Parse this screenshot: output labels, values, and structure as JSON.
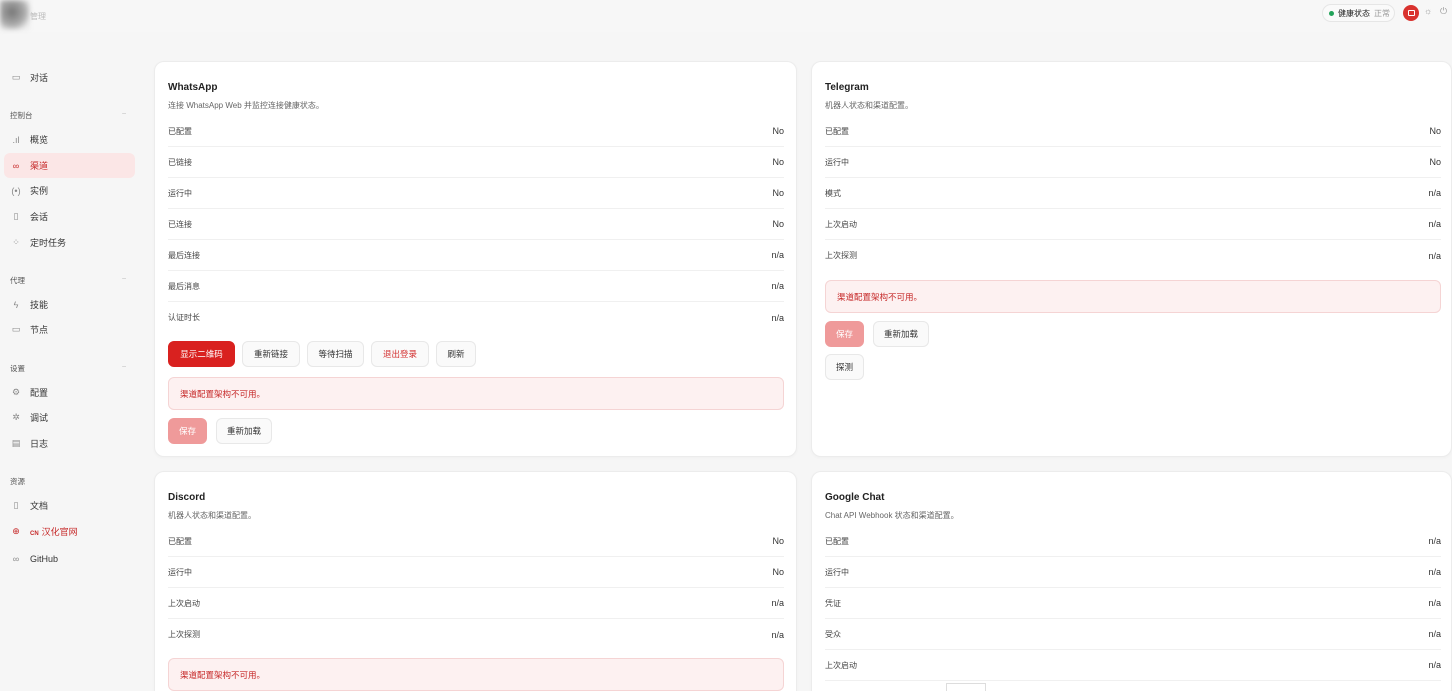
{
  "topbar": {
    "logo_text": "管理",
    "health_label": "健康状态",
    "health_status": "正常",
    "health_color": "#22a35a",
    "accent": "#d9322e",
    "icons": [
      "chat-icon",
      "sun-icon",
      "power-icon"
    ]
  },
  "sidebar": {
    "chat": "对话",
    "groups": {
      "control": "控制台",
      "agent": "代理",
      "settings": "设置",
      "resources": "资源"
    },
    "items": {
      "overview": "概览",
      "channels": "渠道",
      "instances": "实例",
      "sessions": "会话",
      "cron": "定时任务",
      "skills": "技能",
      "nodes": "节点",
      "config": "配置",
      "debug": "调试",
      "logs": "日志",
      "docs": "文档",
      "cn_badge": "CN",
      "cn_site": "汉化官网",
      "github": "GitHub"
    }
  },
  "whatsapp": {
    "title": "WhatsApp",
    "subtitle": "连接 WhatsApp Web 并监控连接健康状态。",
    "rows": [
      {
        "label": "已配置",
        "value": "No"
      },
      {
        "label": "已链接",
        "value": "No"
      },
      {
        "label": "运行中",
        "value": "No"
      },
      {
        "label": "已连接",
        "value": "No"
      },
      {
        "label": "最后连接",
        "value": "n/a"
      },
      {
        "label": "最后消息",
        "value": "n/a"
      },
      {
        "label": "认证时长",
        "value": "n/a"
      }
    ],
    "buttons": {
      "show_qr": "显示二维码",
      "relink": "重新链接",
      "wait_scan": "等待扫描",
      "logout": "退出登录",
      "refresh": "刷新",
      "save": "保存",
      "reload": "重新加载"
    },
    "alert": "渠道配置架构不可用。"
  },
  "telegram": {
    "title": "Telegram",
    "subtitle": "机器人状态和渠道配置。",
    "rows": [
      {
        "label": "已配置",
        "value": "No"
      },
      {
        "label": "运行中",
        "value": "No"
      },
      {
        "label": "模式",
        "value": "n/a"
      },
      {
        "label": "上次启动",
        "value": "n/a"
      },
      {
        "label": "上次探测",
        "value": "n/a"
      }
    ],
    "alert": "渠道配置架构不可用。",
    "buttons": {
      "save": "保存",
      "reload": "重新加载",
      "probe": "探测"
    }
  },
  "discord": {
    "title": "Discord",
    "subtitle": "机器人状态和渠道配置。",
    "rows": [
      {
        "label": "已配置",
        "value": "No"
      },
      {
        "label": "运行中",
        "value": "No"
      },
      {
        "label": "上次启动",
        "value": "n/a"
      },
      {
        "label": "上次探测",
        "value": "n/a"
      }
    ],
    "alert": "渠道配置架构不可用。"
  },
  "googlechat": {
    "title": "Google Chat",
    "subtitle": "Chat API Webhook 状态和渠道配置。",
    "rows": [
      {
        "label": "已配置",
        "value": "n/a"
      },
      {
        "label": "运行中",
        "value": "n/a"
      },
      {
        "label": "凭证",
        "value": "n/a"
      },
      {
        "label": "受众",
        "value": "n/a"
      },
      {
        "label": "上次启动",
        "value": "n/a"
      }
    ]
  }
}
